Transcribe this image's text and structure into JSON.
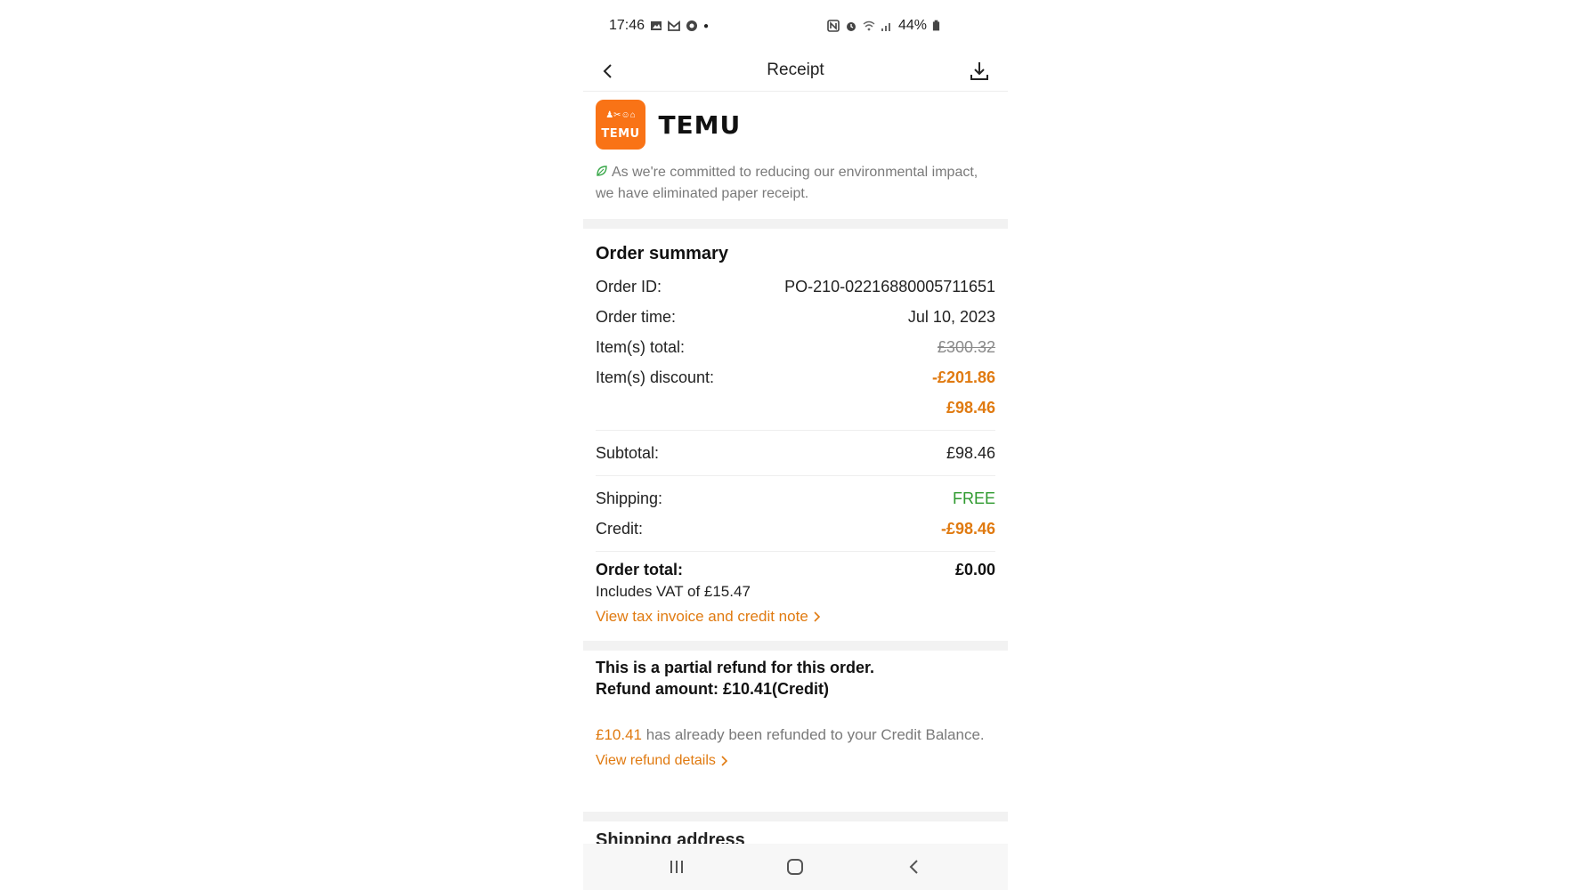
{
  "status_bar": {
    "time": "17:46",
    "battery": "44%"
  },
  "header": {
    "title": "Receipt"
  },
  "brand": {
    "logo_small_text": "TEMU",
    "wordmark": "TEMU",
    "eco_message": "As we're committed to reducing our environmental impact, we have eliminated paper receipt."
  },
  "summary": {
    "heading": "Order summary",
    "order_id_label": "Order ID:",
    "order_id_value": "PO-210-02216880005711651",
    "order_time_label": "Order time:",
    "order_time_value": "Jul 10, 2023",
    "items_total_label": "Item(s) total:",
    "items_total_value": "£300.32",
    "items_discount_label": "Item(s) discount:",
    "items_discount_value": "-£201.86",
    "items_net_value": "£98.46",
    "subtotal_label": "Subtotal:",
    "subtotal_value": "£98.46",
    "shipping_label": "Shipping:",
    "shipping_value": "FREE",
    "credit_label": "Credit:",
    "credit_value": "-£98.46",
    "order_total_label": "Order total:",
    "order_total_value": "£0.00",
    "vat_text": "Includes VAT of £15.47",
    "invoice_link": "View tax invoice and credit note"
  },
  "refund": {
    "line1": "This is a partial refund for this order.",
    "line2": "Refund amount: £10.41(Credit)",
    "amount": "£10.41",
    "info_text": " has already been refunded to your Credit Balance.",
    "details_link": "View refund details"
  },
  "next_section": {
    "heading": "Shipping address"
  },
  "colors": {
    "accent": "#e07a10",
    "brand": "#f97316",
    "free": "#2f9a2f"
  }
}
